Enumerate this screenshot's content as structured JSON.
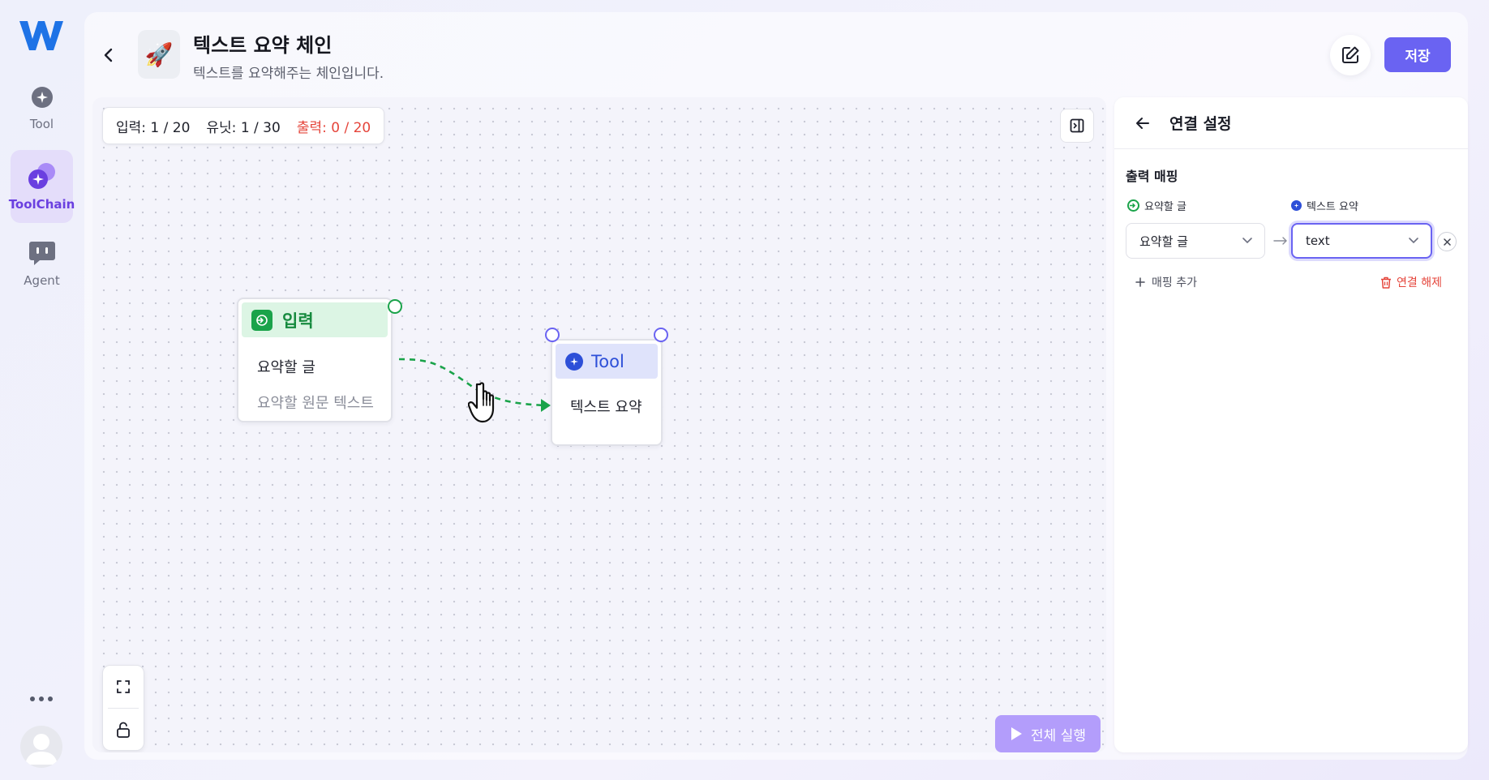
{
  "rail": {
    "items": [
      {
        "label": "Tool"
      },
      {
        "label": "ToolChain"
      },
      {
        "label": "Agent"
      }
    ]
  },
  "header": {
    "title": "텍스트 요약 체인",
    "subtitle": "텍스트를 요약해주는 체인입니다.",
    "save_label": "저장"
  },
  "canvas": {
    "counts": {
      "input": "입력: 1 / 20",
      "unit": "유닛: 1 / 30",
      "output": "출력: 0 / 20"
    },
    "input_node": {
      "title": "입력",
      "field_name": "요약할 글",
      "field_desc": "요약할 원문 텍스트"
    },
    "tool_node": {
      "title": "Tool",
      "field_name": "텍스트 요약"
    },
    "run_label": "전체 실행"
  },
  "side_panel": {
    "title": "연결 설정",
    "section_title": "출력 매핑",
    "source_label": "요약할 글",
    "target_label": "텍스트 요약",
    "source_value": "요약할 글",
    "target_value": "text",
    "add_mapping": "매핑 추가",
    "unlink": "연결 해제"
  },
  "colors": {
    "accent": "#6a63f2",
    "input_green": "#1aa34a",
    "tool_blue": "#2d4fd8",
    "danger": "#e5453b",
    "active_purple": "#6a3fe0"
  }
}
